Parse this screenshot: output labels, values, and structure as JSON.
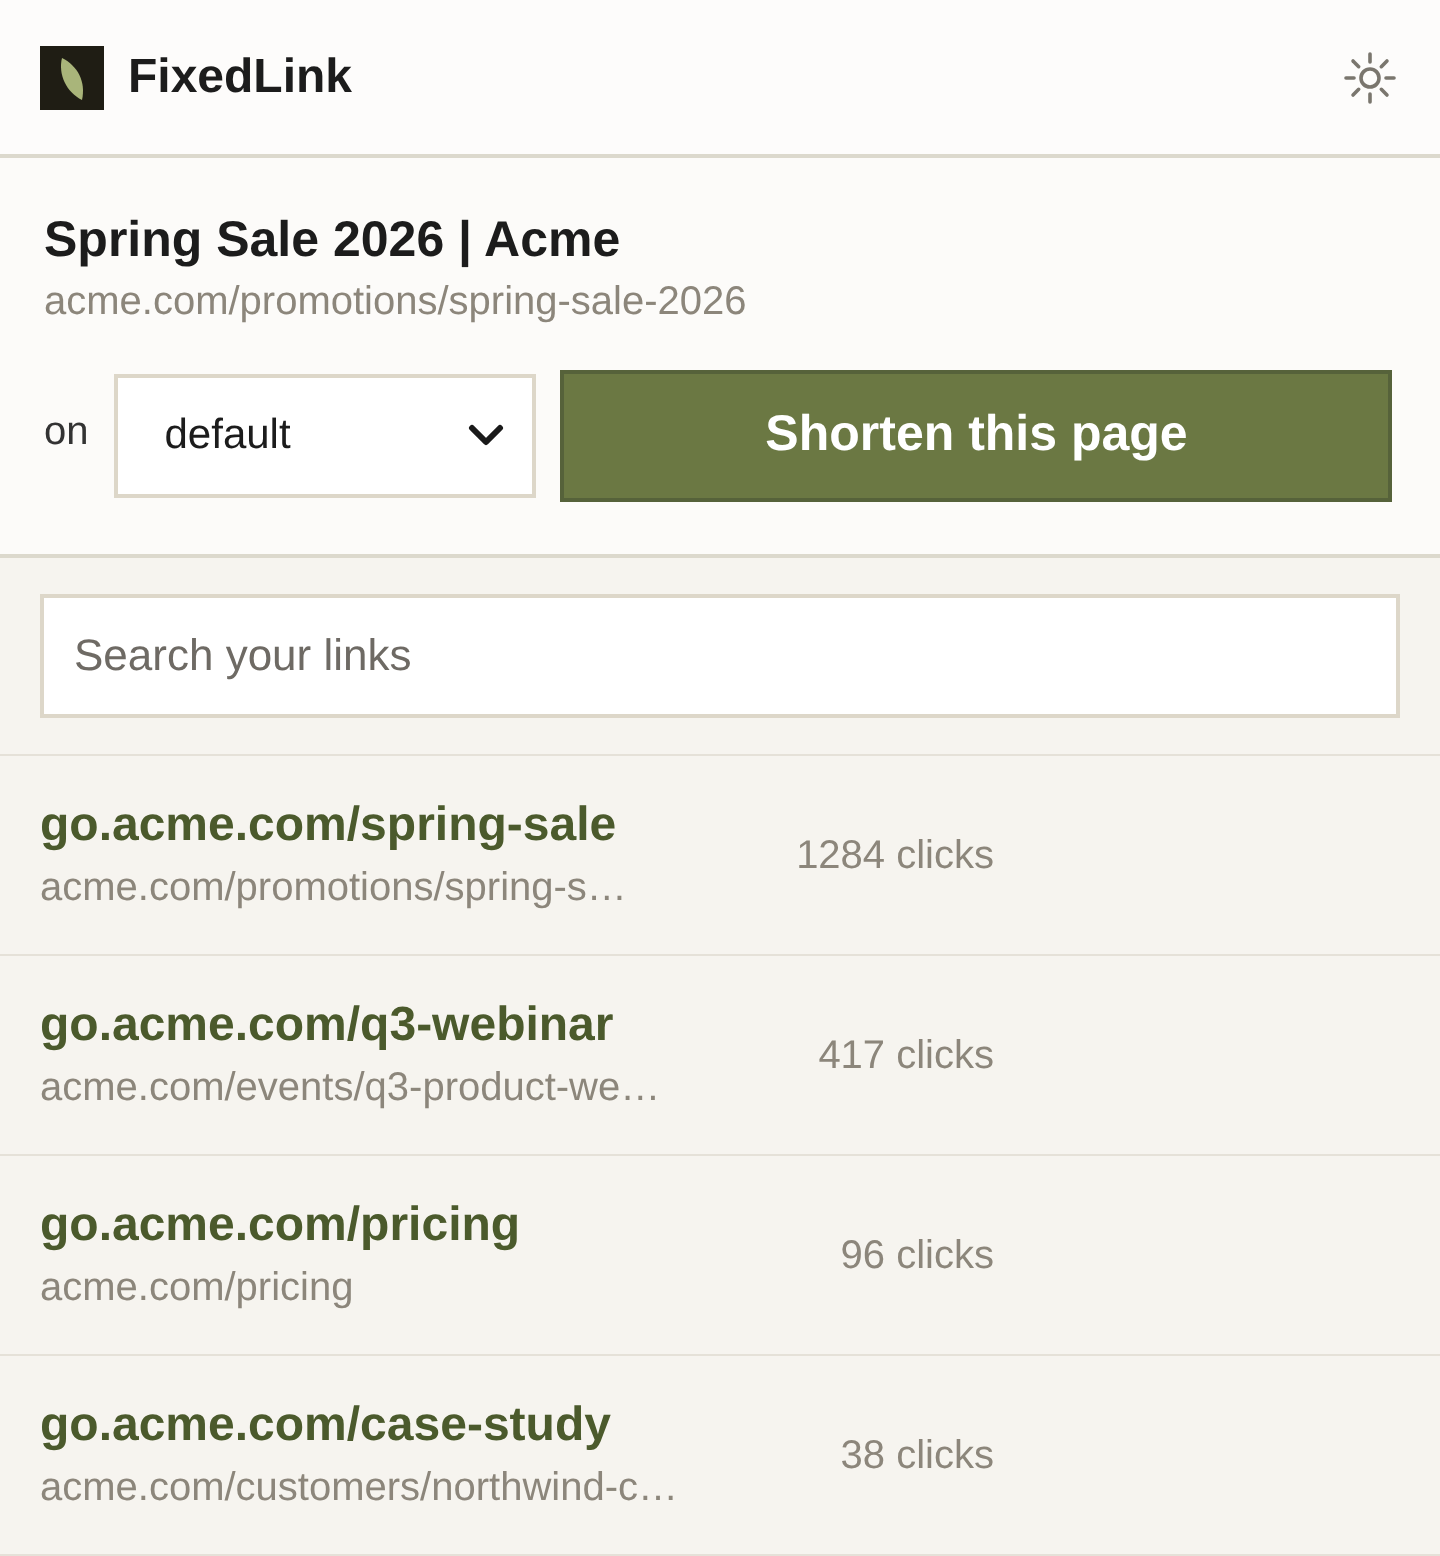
{
  "app": {
    "name": "FixedLink"
  },
  "current_page": {
    "title": "Spring Sale 2026 | Acme",
    "url": "acme.com/promotions/spring-sale-2026",
    "domain_label": "on",
    "domain_select": {
      "value": "default"
    },
    "shorten_button": "Shorten this page"
  },
  "search": {
    "placeholder": "Search your links"
  },
  "links": [
    {
      "short_url": "go.acme.com/spring-sale",
      "destination": "acme.com/promotions/spring-s…",
      "clicks": "1284 clicks"
    },
    {
      "short_url": "go.acme.com/q3-webinar",
      "destination": "acme.com/events/q3-product-we…",
      "clicks": "417 clicks"
    },
    {
      "short_url": "go.acme.com/pricing",
      "destination": "acme.com/pricing",
      "clicks": "96 clicks"
    },
    {
      "short_url": "go.acme.com/case-study",
      "destination": "acme.com/customers/northwind-c…",
      "clicks": "38 clicks"
    }
  ]
}
